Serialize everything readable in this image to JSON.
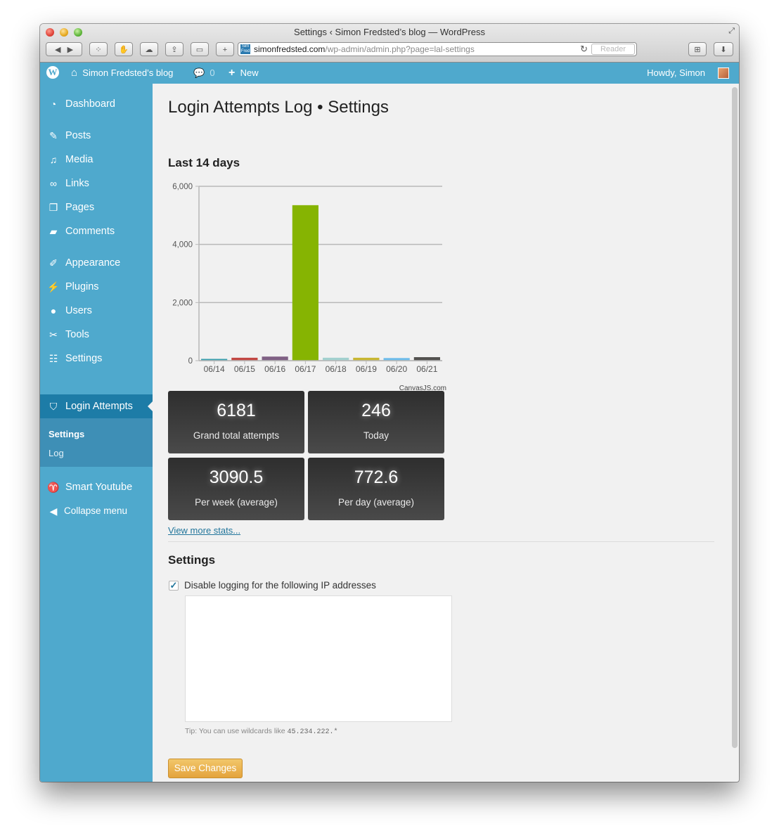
{
  "window": {
    "title": "Settings ‹ Simon Fredsted’s blog — WordPress"
  },
  "browser": {
    "url_host": "simonfredsted.com",
    "url_path": "/wp-admin/admin.php?page=lal-settings",
    "reader_label": "Reader",
    "favicon_text": "Sim Fred"
  },
  "adminbar": {
    "site_name": "Simon Fredsted’s blog",
    "comments_count": "0",
    "new_label": "New",
    "greeting": "Howdy, Simon"
  },
  "sidebar": {
    "items": [
      {
        "label": "Dashboard",
        "icon": "dashboard-icon"
      },
      {
        "label": "Posts",
        "icon": "pin-icon"
      },
      {
        "label": "Media",
        "icon": "media-icon"
      },
      {
        "label": "Links",
        "icon": "link-icon"
      },
      {
        "label": "Pages",
        "icon": "pages-icon"
      },
      {
        "label": "Comments",
        "icon": "comment-icon"
      },
      {
        "label": "Appearance",
        "icon": "brush-icon"
      },
      {
        "label": "Plugins",
        "icon": "plug-icon"
      },
      {
        "label": "Users",
        "icon": "user-icon"
      },
      {
        "label": "Tools",
        "icon": "wrench-icon"
      },
      {
        "label": "Settings",
        "icon": "settings-sliders-icon"
      },
      {
        "label": "Login Attempts",
        "icon": "shield-icon"
      },
      {
        "label": "Smart Youtube",
        "icon": "youtube-icon"
      },
      {
        "label": "Collapse menu",
        "icon": "collapse-icon"
      }
    ],
    "submenu": [
      {
        "label": "Settings"
      },
      {
        "label": "Log"
      }
    ]
  },
  "page": {
    "title": "Login Attempts Log • Settings",
    "chart_heading": "Last 14 days",
    "credit": "CanvasJS.com",
    "stats": [
      {
        "value": "6181",
        "label": "Grand total attempts"
      },
      {
        "value": "246",
        "label": "Today"
      },
      {
        "value": "3090.5",
        "label": "Per week (average)"
      },
      {
        "value": "772.6",
        "label": "Per day (average)"
      }
    ],
    "more_link": "View more stats...",
    "settings_heading": "Settings",
    "checkbox_label": "Disable logging for the following IP addresses",
    "checkbox_checked": true,
    "textarea_value": "",
    "tip_text": "Tip: You can use wildcards like",
    "tip_code": "45.234.222.*",
    "save_label": "Save Changes"
  },
  "chart_data": {
    "type": "bar",
    "categories": [
      "06/14",
      "06/15",
      "06/16",
      "06/17",
      "06/18",
      "06/19",
      "06/20",
      "06/21"
    ],
    "values": [
      60,
      100,
      140,
      5350,
      100,
      100,
      90,
      120
    ],
    "colors": [
      "#369ead",
      "#c24642",
      "#7f6084",
      "#86b402",
      "#a2d1cf",
      "#c8b631",
      "#6dbceb",
      "#52514e"
    ],
    "yticks": [
      "0",
      "2,000",
      "4,000",
      "6,000"
    ],
    "ytick_values": [
      0,
      2000,
      4000,
      6000
    ],
    "ylim": [
      0,
      6000
    ],
    "grid": true
  }
}
